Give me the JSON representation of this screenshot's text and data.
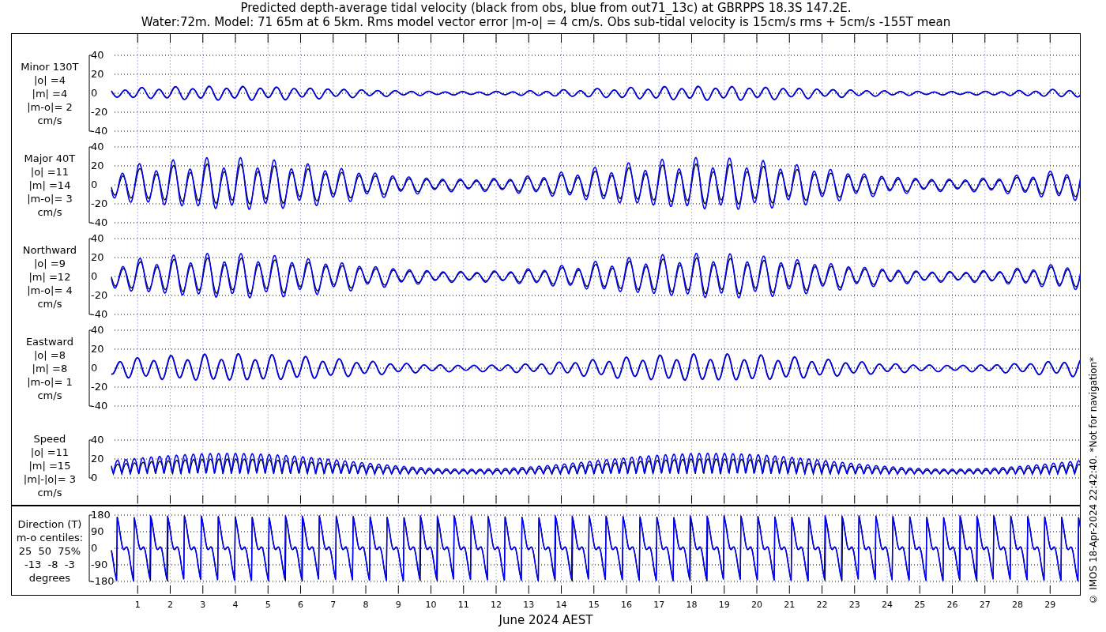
{
  "title": [
    "Predicted depth-average tidal velocity (black from obs, blue from out71_13c) at GBRPPS 18.3S 147.2E.",
    "Water:72m. Model: 71 65m at 6 5km. Rms model vector error |m-o| = 4 cm/s. Obs sub-tidal velocity is 15cm/s rms + 5cm/s -155T mean"
  ],
  "panels": [
    {
      "kind": "signed",
      "label": [
        "Minor 130T",
        "|o| =4",
        "|m| =4",
        "|m-o|= 2",
        "cm/s"
      ],
      "yticks": [
        "40",
        "20",
        "0",
        "-20",
        "-40"
      ]
    },
    {
      "kind": "signed",
      "label": [
        "Major 40T",
        "|o| =11",
        "|m| =14",
        "|m-o|= 3",
        "cm/s"
      ],
      "yticks": [
        "40",
        "20",
        "0",
        "-20",
        "-40"
      ]
    },
    {
      "kind": "signed",
      "label": [
        "Northward",
        "|o| =9",
        "|m| =12",
        "|m-o|= 4",
        "cm/s"
      ],
      "yticks": [
        "40",
        "20",
        "0",
        "-20",
        "-40"
      ]
    },
    {
      "kind": "signed",
      "label": [
        "Eastward",
        "|o| =8",
        "|m| =8",
        "|m-o|= 1",
        "cm/s"
      ],
      "yticks": [
        "40",
        "20",
        "0",
        "-20",
        "-40"
      ]
    },
    {
      "kind": "speed",
      "label": [
        "Speed",
        "|o| =11",
        "|m| =15",
        "|m|-|o|= 3",
        "cm/s"
      ],
      "yticks": [
        "40",
        "20",
        "0"
      ]
    },
    {
      "kind": "direction",
      "label": [
        "Direction (T)",
        "m-o centiles:",
        "25  50  75%",
        "-13  -8  -3",
        "degrees"
      ],
      "yticks": [
        "180",
        "90",
        "0",
        "-90",
        "-180"
      ]
    }
  ],
  "days": [
    "1",
    "2",
    "3",
    "4",
    "5",
    "6",
    "7",
    "8",
    "9",
    "10",
    "11",
    "12",
    "13",
    "14",
    "15",
    "16",
    "17",
    "18",
    "19",
    "20",
    "21",
    "22",
    "23",
    "24",
    "25",
    "26",
    "27",
    "28",
    "29"
  ],
  "xlabel": "June 2024 AEST",
  "credit": "© IMOS 18-Apr-2024 22:42:40. *Not for navigation*"
}
